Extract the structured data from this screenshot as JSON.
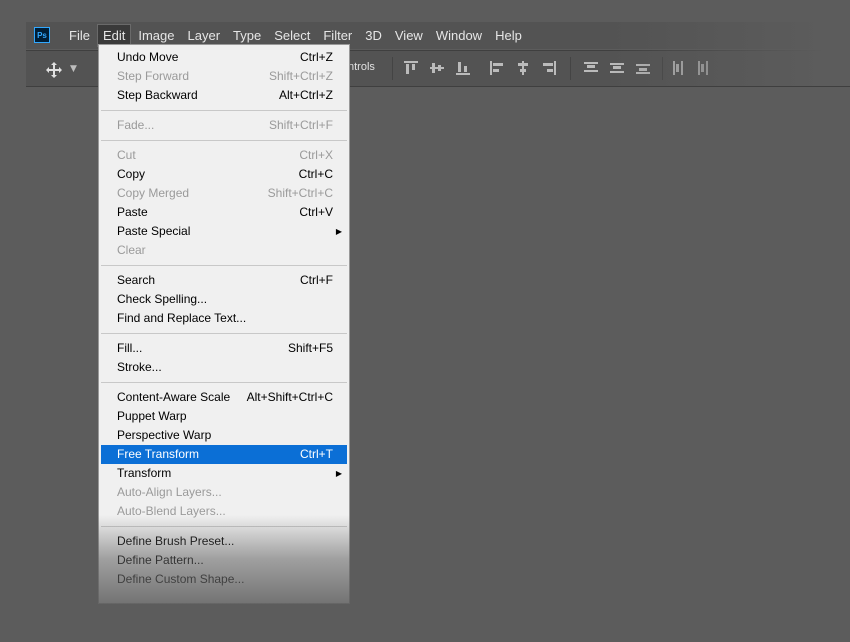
{
  "app": {
    "logo_text": "Ps",
    "brand_color": "#31a8ff"
  },
  "menubar": {
    "items": [
      "File",
      "Edit",
      "Image",
      "Layer",
      "Type",
      "Select",
      "Filter",
      "3D",
      "View",
      "Window",
      "Help"
    ],
    "active": "Edit"
  },
  "optionsbar": {
    "controls_text": "ntrols"
  },
  "edit_menu": {
    "items": [
      {
        "label": "Undo Move",
        "shortcut": "Ctrl+Z",
        "enabled": true
      },
      {
        "label": "Step Forward",
        "shortcut": "Shift+Ctrl+Z",
        "enabled": false
      },
      {
        "label": "Step Backward",
        "shortcut": "Alt+Ctrl+Z",
        "enabled": true
      },
      {
        "label": "Fade...",
        "shortcut": "Shift+Ctrl+F",
        "enabled": false
      },
      {
        "label": "Cut",
        "shortcut": "Ctrl+X",
        "enabled": false
      },
      {
        "label": "Copy",
        "shortcut": "Ctrl+C",
        "enabled": true
      },
      {
        "label": "Copy Merged",
        "shortcut": "Shift+Ctrl+C",
        "enabled": false
      },
      {
        "label": "Paste",
        "shortcut": "Ctrl+V",
        "enabled": true
      },
      {
        "label": "Paste Special",
        "shortcut": "",
        "enabled": true,
        "submenu": true
      },
      {
        "label": "Clear",
        "shortcut": "",
        "enabled": false
      },
      {
        "label": "Search",
        "shortcut": "Ctrl+F",
        "enabled": true
      },
      {
        "label": "Check Spelling...",
        "shortcut": "",
        "enabled": true
      },
      {
        "label": "Find and Replace Text...",
        "shortcut": "",
        "enabled": true
      },
      {
        "label": "Fill...",
        "shortcut": "Shift+F5",
        "enabled": true
      },
      {
        "label": "Stroke...",
        "shortcut": "",
        "enabled": true
      },
      {
        "label": "Content-Aware Scale",
        "shortcut": "Alt+Shift+Ctrl+C",
        "enabled": true
      },
      {
        "label": "Puppet Warp",
        "shortcut": "",
        "enabled": true
      },
      {
        "label": "Perspective Warp",
        "shortcut": "",
        "enabled": true
      },
      {
        "label": "Free Transform",
        "shortcut": "Ctrl+T",
        "enabled": true,
        "highlighted": true
      },
      {
        "label": "Transform",
        "shortcut": "",
        "enabled": true,
        "submenu": true
      },
      {
        "label": "Auto-Align Layers...",
        "shortcut": "",
        "enabled": false
      },
      {
        "label": "Auto-Blend Layers...",
        "shortcut": "",
        "enabled": false
      },
      {
        "label": "Define Brush Preset...",
        "shortcut": "",
        "enabled": true
      },
      {
        "label": "Define Pattern...",
        "shortcut": "",
        "enabled": true
      },
      {
        "label": "Define Custom Shape...",
        "shortcut": "",
        "enabled": true
      }
    ],
    "highlight_color": "#0b6fd6"
  }
}
